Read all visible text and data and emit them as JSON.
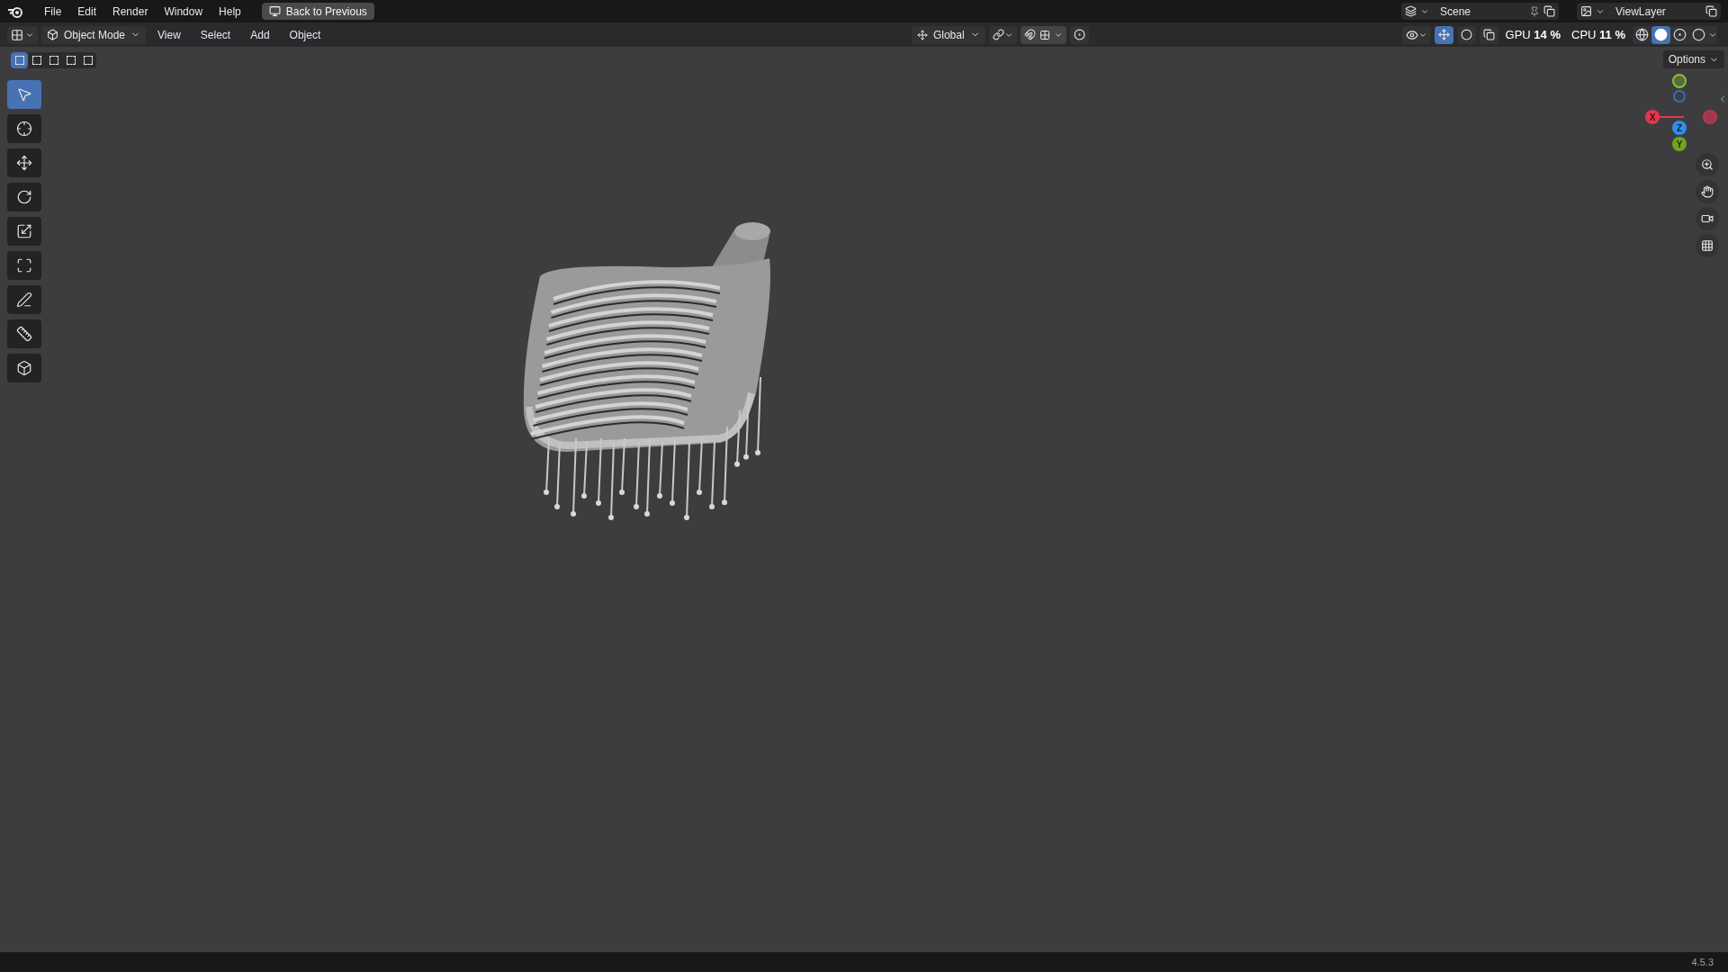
{
  "menu_bar": {
    "items": [
      {
        "label": "File"
      },
      {
        "label": "Edit"
      },
      {
        "label": "Render"
      },
      {
        "label": "Window"
      },
      {
        "label": "Help"
      }
    ],
    "back_button": "Back to Previous"
  },
  "scene": {
    "name": "Scene"
  },
  "view_layer": {
    "name": "ViewLayer"
  },
  "monitor": [
    {
      "label": "GPU",
      "value": "14 %"
    },
    {
      "label": "CPU",
      "value": "11 %"
    }
  ],
  "header": {
    "mode": "Object Mode",
    "menus": [
      "View",
      "Select",
      "Add",
      "Object"
    ],
    "orientation": "Global"
  },
  "select_modes": [
    {
      "selected": true
    },
    {
      "selected": false
    },
    {
      "selected": false
    },
    {
      "selected": false
    },
    {
      "selected": false
    }
  ],
  "shading": [
    {
      "kind": "wireframe",
      "selected": false
    },
    {
      "kind": "solid",
      "selected": true
    },
    {
      "kind": "material",
      "selected": false
    },
    {
      "kind": "rendered",
      "selected": false
    }
  ],
  "options_button": "Options",
  "toolbar": [
    {
      "kind": "select",
      "selected": true
    },
    {
      "kind": "cursor",
      "selected": false
    },
    {
      "kind": "move",
      "selected": false
    },
    {
      "kind": "rotate",
      "selected": false
    },
    {
      "kind": "scale",
      "selected": false
    },
    {
      "kind": "transform",
      "selected": false
    },
    {
      "kind": "annotate",
      "selected": false
    },
    {
      "kind": "measure",
      "selected": false
    },
    {
      "kind": "add-cube",
      "selected": false
    }
  ],
  "axes": [
    {
      "label": "X",
      "color": "#e5344e"
    },
    {
      "label": "Z",
      "color": "#2f8fef"
    },
    {
      "label": "Y",
      "color": "#6fa51f"
    }
  ],
  "version": "4.5.3"
}
